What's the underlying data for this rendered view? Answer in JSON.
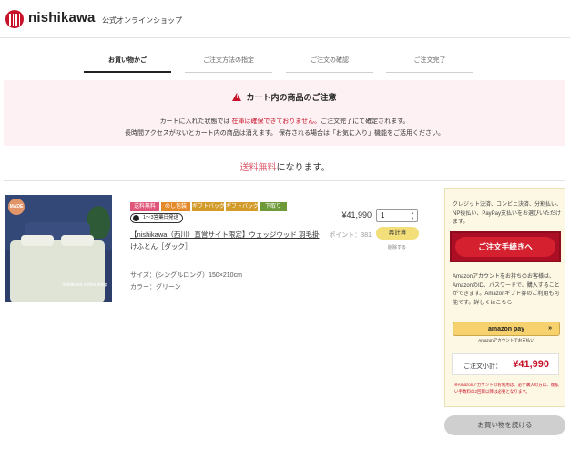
{
  "header": {
    "logo_text": "nishikawa",
    "logo_sub": "公式オンラインショップ"
  },
  "steps": [
    {
      "label": "お買い物かご",
      "active": true
    },
    {
      "label": "ご注文方法の指定",
      "active": false
    },
    {
      "label": "ご注文の確認",
      "active": false
    },
    {
      "label": "ご注文完了",
      "active": false
    }
  ],
  "notice": {
    "title": "カート内の商品のご注意",
    "line1_pre": "カートに入れた状態では ",
    "line1_red": "在庫は確保できておりません。",
    "line1_post": "ご注文完了にて確定されます。",
    "line2": "長時間アクセスがないとカート内の商品は消えます。 保存される場合は「お気に入り」機能をご活用ください。"
  },
  "shipping": {
    "red": "送料無料",
    "rest": "になります。"
  },
  "product": {
    "image_badge": "MADE",
    "image_text": "nishikawa online shop",
    "tags": [
      {
        "label": "送料無料",
        "color": "#e0557a"
      },
      {
        "label": "のし包装",
        "color": "#e58a2b"
      },
      {
        "label": "ギフトバッグ",
        "color": "#d39b2a"
      },
      {
        "label": "ギフトバッグ",
        "color": "#d39b2a"
      },
      {
        "label": "下取り",
        "color": "#6e9a3a"
      }
    ],
    "delivery": "1〜3営業日発送",
    "name": "【nishikawa（西川）直営サイト限定】ウェッジウッド 羽毛掛けふとん［ダック］",
    "size": "サイズ：(シングルロング）150×210cm",
    "color": "カラー：グリーン",
    "price": "¥41,990",
    "quantity": "1",
    "points": "ポイント：381",
    "recalc_label": "再計算",
    "delete_label": "削除する"
  },
  "sidebar": {
    "note": "クレジット決済、コンビニ決済、分割払い、NP後払い、PayPay支払いをお選びいただけます。",
    "order_button": "ご注文手続きへ",
    "amazon_note": "Amazonアカウントをお持ちのお客様は、AmazonのID、パスワードで、購入することができます。Amazonギフト券のご利用も可能です。詳しくはこちら",
    "amazon_button": "amazon pay",
    "amazon_sub": "Amazonアカウントでお支払い",
    "subtotal_label": "ご注文小計：",
    "subtotal_value": "¥41,990",
    "fine_print": "※Amazonアカウントのお利用は、必ず購入の方は、後払い手数料の2回目以降は必要となります。"
  },
  "continue_button": "お買い物を続ける"
}
